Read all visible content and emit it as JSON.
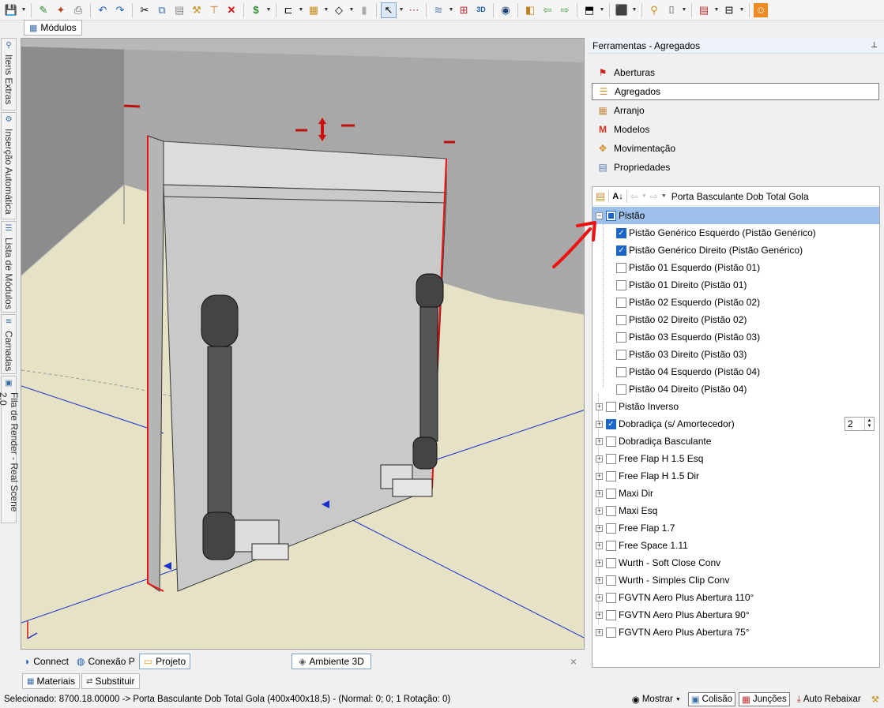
{
  "toolbar": {
    "icons": [
      "save-icon",
      "pencil-icon",
      "wizard-icon",
      "print-icon",
      "undo-icon",
      "redo-icon",
      "cut-icon",
      "copy-icon",
      "paste-icon",
      "brush-icon",
      "delete-icon",
      "money-icon",
      "layout-icon",
      "grid-icon",
      "shape-icon",
      "separator-icon",
      "select-icon",
      "measure-icon",
      "layers-icon",
      "dimension-icon",
      "3d-icon",
      "eye-icon",
      "mirror-icon",
      "arrow-left-icon",
      "arrow-right-icon",
      "view-icon",
      "cube-icon",
      "wand-icon",
      "camera-icon",
      "report-icon",
      "settings-icon",
      "user-icon"
    ]
  },
  "top_tab": {
    "label": "Módulos"
  },
  "left_tabs": [
    {
      "label": "Itens Extras"
    },
    {
      "label": "Inserção Automática"
    },
    {
      "label": "Lista de Módulos"
    },
    {
      "label": "Camadas"
    },
    {
      "label": "Fila de Render - Real Scene 2.0"
    }
  ],
  "viewport_tabs": [
    {
      "label": "Connect",
      "icon": "rss-icon"
    },
    {
      "label": "Conexão P",
      "icon": "globe-icon"
    },
    {
      "label": "Projeto",
      "icon": "folder-icon"
    },
    {
      "label": "Ambiente 3D",
      "icon": "render-icon"
    }
  ],
  "close_glyph": "×",
  "panel": {
    "title": "Ferramentas - Agregados",
    "pin": "📌",
    "nav": [
      {
        "label": "Aberturas",
        "icon": "flag-icon",
        "color": "#cc2222"
      },
      {
        "label": "Agregados",
        "icon": "aggregates-icon",
        "color": "#c8902c"
      },
      {
        "label": "Arranjo",
        "icon": "arrange-icon",
        "color": "#c28a4a"
      },
      {
        "label": "Modelos",
        "icon": "models-icon",
        "color": "#d03020"
      },
      {
        "label": "Movimentação",
        "icon": "move-icon",
        "color": "#d08a20"
      },
      {
        "label": "Propriedades",
        "icon": "properties-icon",
        "color": "#5a7fb0"
      }
    ],
    "tree_title": "Porta Basculante Dob Total Gola",
    "root": {
      "label": "Pistão",
      "state": "partial"
    },
    "children": [
      {
        "label": "Pistão Genérico Esquerdo (Pistão Genérico)",
        "checked": true
      },
      {
        "label": "Pistão Genérico Direito (Pistão Genérico)",
        "checked": true
      },
      {
        "label": "Pistão 01 Esquerdo (Pistão 01)",
        "checked": false
      },
      {
        "label": "Pistão 01 Direito (Pistão 01)",
        "checked": false
      },
      {
        "label": "Pistão 02 Esquerdo (Pistão 02)",
        "checked": false
      },
      {
        "label": "Pistão 02 Direito (Pistão 02)",
        "checked": false
      },
      {
        "label": "Pistão 03 Esquerdo (Pistão 03)",
        "checked": false
      },
      {
        "label": "Pistão 03 Direito (Pistão 03)",
        "checked": false
      },
      {
        "label": "Pistão 04 Esquerdo (Pistão 04)",
        "checked": false
      },
      {
        "label": "Pistão 04 Direito (Pistão 04)",
        "checked": false
      }
    ],
    "groups": [
      {
        "label": "Pistão Inverso",
        "checked": false
      },
      {
        "label": "Dobradiça (s/ Amortecedor)",
        "checked": true,
        "qty": "2"
      },
      {
        "label": "Dobradiça Basculante",
        "checked": false
      },
      {
        "label": "Free Flap H 1.5 Esq",
        "checked": false
      },
      {
        "label": "Free Flap H 1.5 Dir",
        "checked": false
      },
      {
        "label": "Maxi Dir",
        "checked": false
      },
      {
        "label": "Maxi Esq",
        "checked": false
      },
      {
        "label": "Free Flap 1.7",
        "checked": false
      },
      {
        "label": "Free Space 1.11",
        "checked": false
      },
      {
        "label": "Wurth - Soft Close Conv",
        "checked": false
      },
      {
        "label": "Wurth - Simples Clip Conv",
        "checked": false
      },
      {
        "label": "FGVTN Aero Plus Abertura 110°",
        "checked": false
      },
      {
        "label": "FGVTN Aero Plus Abertura 90°",
        "checked": false
      },
      {
        "label": "FGVTN Aero Plus Abertura 75°",
        "checked": false
      }
    ]
  },
  "material_tabs": [
    {
      "label": "Materiais",
      "icon": "materials-icon"
    },
    {
      "label": "Substituir",
      "icon": "replace-icon"
    }
  ],
  "status": {
    "text": "Selecionado: 8700.18.00000 -> Porta Basculante Dob Total Gola (400x400x18,5) - (Normal: 0; 0; 1 Rotação: 0)",
    "mostrar": "Mostrar",
    "colisao": "Colisão",
    "juncoes": "Junções",
    "auto_rebaixar": "Auto Rebaixar"
  },
  "colors": {
    "accent": "#1a66c9",
    "selection": "#9dc1ea",
    "annotation_arrow": "#ee1111",
    "floor": "#e8e4c8",
    "wall": "#8a8a8a"
  }
}
